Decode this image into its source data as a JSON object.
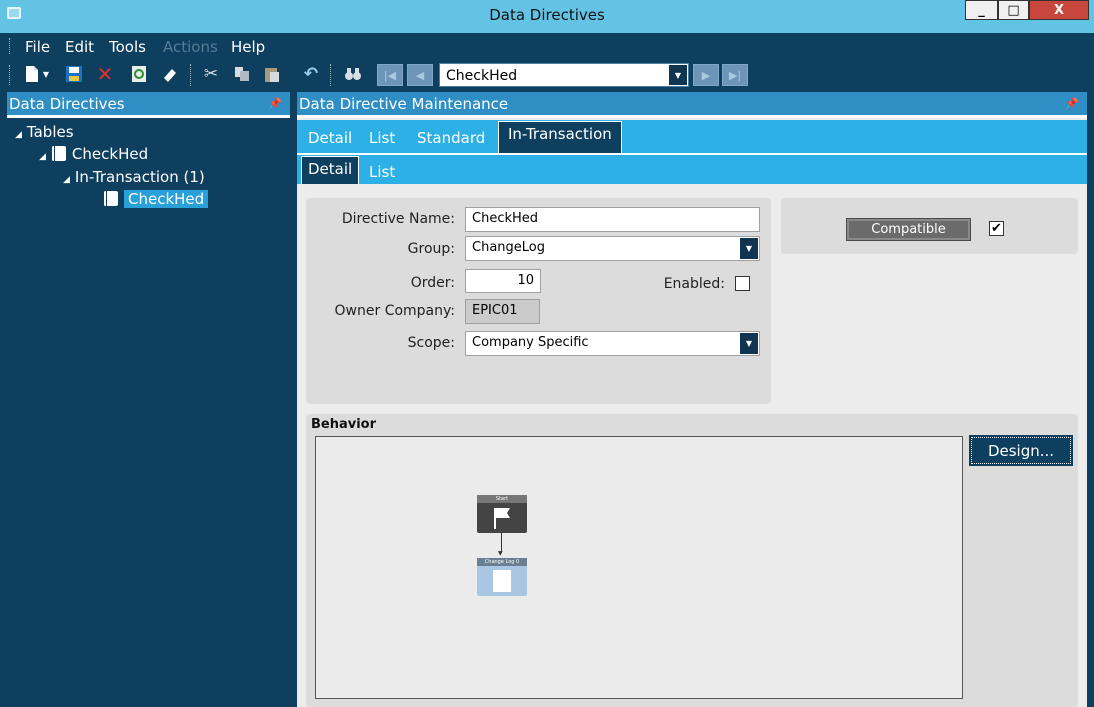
{
  "window": {
    "title": "Data Directives",
    "controls": {
      "minimize": "_",
      "maximize": "□",
      "close": "X"
    }
  },
  "menu": {
    "items": [
      "File",
      "Edit",
      "Tools",
      "Actions",
      "Help"
    ],
    "disabled": [
      "Actions"
    ]
  },
  "toolbar": {
    "icons": [
      "new-icon",
      "save-icon",
      "delete-icon",
      "refresh-icon",
      "eraser-icon",
      "cut-icon",
      "copy-icon",
      "paste-icon",
      "undo-icon",
      "binoculars-icon",
      "first-record-icon",
      "previous-record-icon",
      "next-record-icon",
      "last-record-icon"
    ],
    "nav_value": "CheckHed"
  },
  "left_pane": {
    "title": "Data Directives",
    "tree": {
      "root": "Tables",
      "table": "CheckHed",
      "group": "In-Transaction (1)",
      "selected": "CheckHed"
    }
  },
  "right_pane": {
    "title": "Data Directive Maintenance",
    "tabs": [
      "Detail",
      "List",
      "Standard",
      "In-Transaction"
    ],
    "active_tab": "In-Transaction",
    "subtabs": [
      "Detail",
      "List"
    ],
    "active_subtab": "Detail"
  },
  "form": {
    "directive_name_label": "Directive Name:",
    "directive_name": "CheckHed",
    "group_label": "Group:",
    "group": "ChangeLog",
    "order_label": "Order:",
    "order": "10",
    "enabled_label": "Enabled:",
    "enabled": false,
    "owner_company_label": "Owner Company:",
    "owner_company": "EPIC01",
    "scope_label": "Scope:",
    "scope": "Company Specific"
  },
  "compatible": {
    "label": "Compatible",
    "checked": true,
    "check_mark": "✔"
  },
  "behavior": {
    "title": "Behavior",
    "design_label": "Design...",
    "nodes": [
      {
        "label": "Start"
      },
      {
        "label": "Change Log 0"
      }
    ]
  },
  "colors": {
    "title_bar": "#62c3e5",
    "dark_navy": "#0e3f5e",
    "tab_blue": "#2db0e5",
    "pane_header": "#2f8fc5",
    "selection": "#2aa0d8",
    "close_red": "#c9463d"
  }
}
